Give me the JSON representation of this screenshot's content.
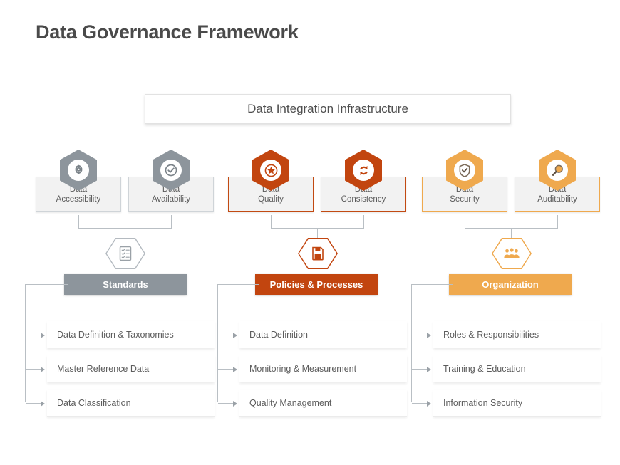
{
  "page": {
    "title": "Data Governance Framework"
  },
  "banner": {
    "label": "Data Integration Infrastructure"
  },
  "colors": {
    "gray": "#8d959c",
    "dark_orange": "#c2450f",
    "light_orange": "#efa94e",
    "connector": "#b9bfc4",
    "title_text": "#4a4a4a",
    "body_text": "#5c5c5c"
  },
  "groups": [
    {
      "key": "standards",
      "accent": "#8d959c",
      "pillars": [
        {
          "line1": "Data",
          "line2": "Accessibility",
          "icon": "gear-icon"
        },
        {
          "line1": "Data",
          "line2": "Availability",
          "icon": "check-circle-icon"
        }
      ],
      "mid_icon": "checklist-document-icon",
      "category": "Standards",
      "items": [
        "Data Definition & Taxonomies",
        "Master Reference Data",
        "Data Classification"
      ]
    },
    {
      "key": "policies",
      "accent": "#c2450f",
      "pillars": [
        {
          "line1": "Data",
          "line2": "Quality",
          "icon": "star-circle-icon"
        },
        {
          "line1": "Data",
          "line2": "Consistency",
          "icon": "sync-refresh-icon"
        }
      ],
      "mid_icon": "save-disk-icon",
      "category": "Policies & Processes",
      "items": [
        "Data Definition",
        "Monitoring  & Measurement",
        "Quality Management"
      ]
    },
    {
      "key": "organization",
      "accent": "#efa94e",
      "pillars": [
        {
          "line1": "Data",
          "line2": "Security",
          "icon": "shield-check-icon"
        },
        {
          "line1": "Data",
          "line2": "Auditability",
          "icon": "magnifier-icon"
        }
      ],
      "mid_icon": "people-group-icon",
      "category": "Organization",
      "items": [
        "Roles & Responsibilities",
        "Training & Education",
        "Information Security"
      ]
    }
  ]
}
